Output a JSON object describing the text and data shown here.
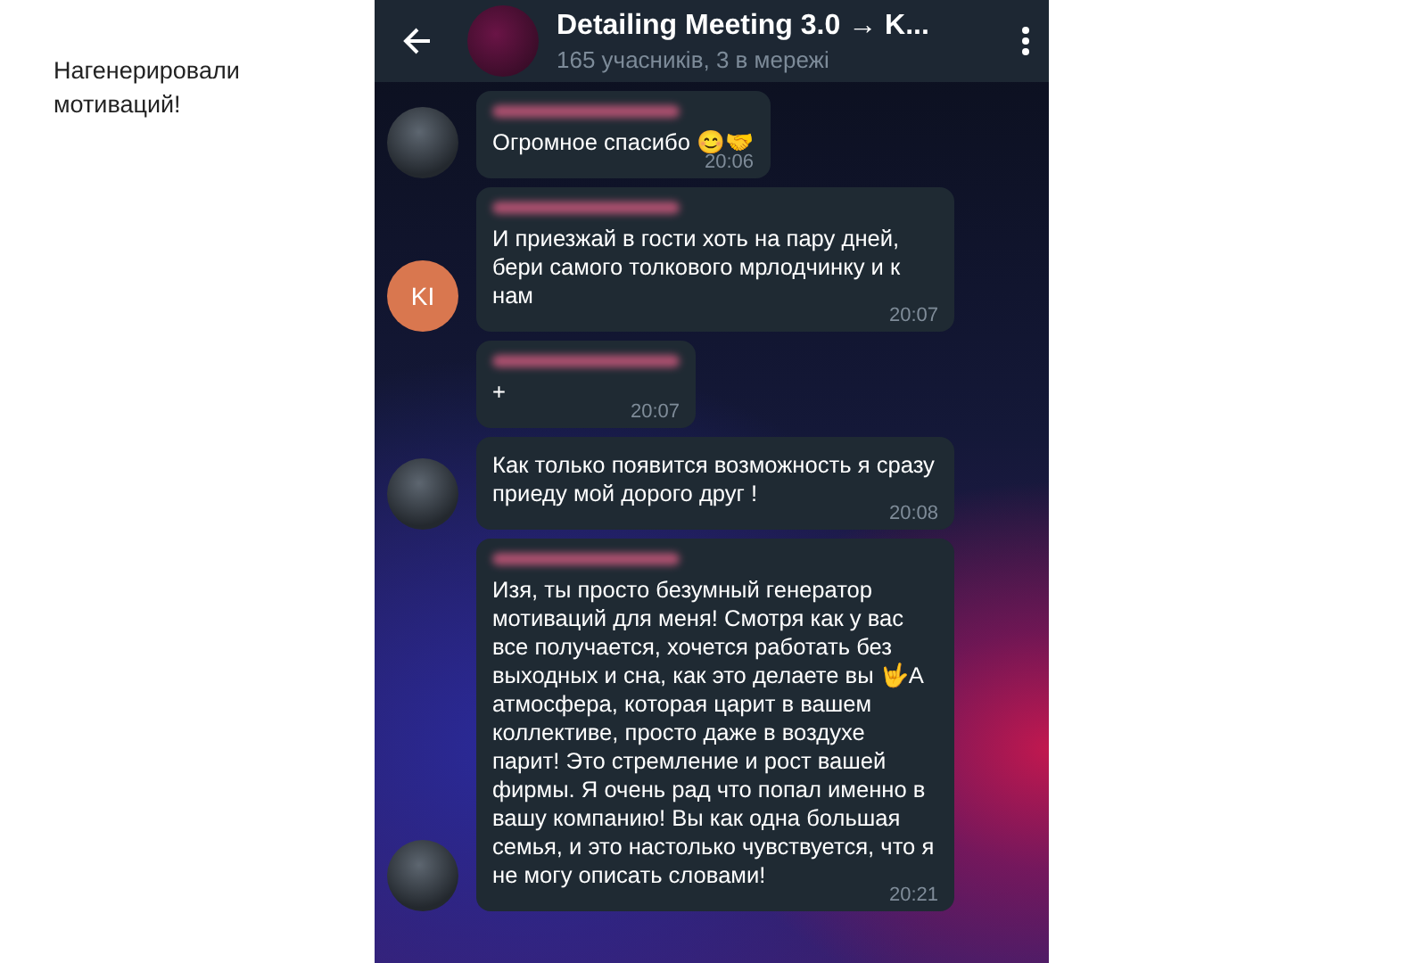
{
  "caption": "Нагенерировали мотиваций!",
  "chat": {
    "title": "Detailing Meeting 3.0 → K...",
    "subtitle": "165 учасників, 3 в мережі"
  },
  "messages": [
    {
      "avatar": {
        "kind": "photo"
      },
      "sender_blurred": true,
      "text": "Огромное спасибо 😊🤝",
      "time": "20:06"
    },
    {
      "avatar": {
        "kind": "initials",
        "initials": "KI",
        "color": "#d9774f"
      },
      "sender_blurred": true,
      "text": "И приезжай в гости хоть на пару дней, бери самого толкового мрлодчинку и к нам",
      "time": "20:07"
    },
    {
      "sender_blurred": true,
      "text": "+",
      "time": "20:07"
    },
    {
      "avatar": {
        "kind": "photo"
      },
      "sender_blurred": false,
      "text": "Как только появится возможность я сразу приеду мой дорого друг !",
      "time": "20:08"
    },
    {
      "avatar": {
        "kind": "photo"
      },
      "sender_blurred": true,
      "text": "Изя, ты просто безумный генератор мотиваций для меня! Смотря как у вас все получается, хочется работать без выходных и  сна, как это делаете вы 🤟А атмосфера, которая царит в вашем коллективе,  просто даже в воздухе парит! Это стремление и рост вашей фирмы. Я очень рад что попал именно в вашу компанию! Вы как одна большая семья, и это настолько чувствуется, что я не могу описать словами!",
      "time": "20:21"
    }
  ]
}
